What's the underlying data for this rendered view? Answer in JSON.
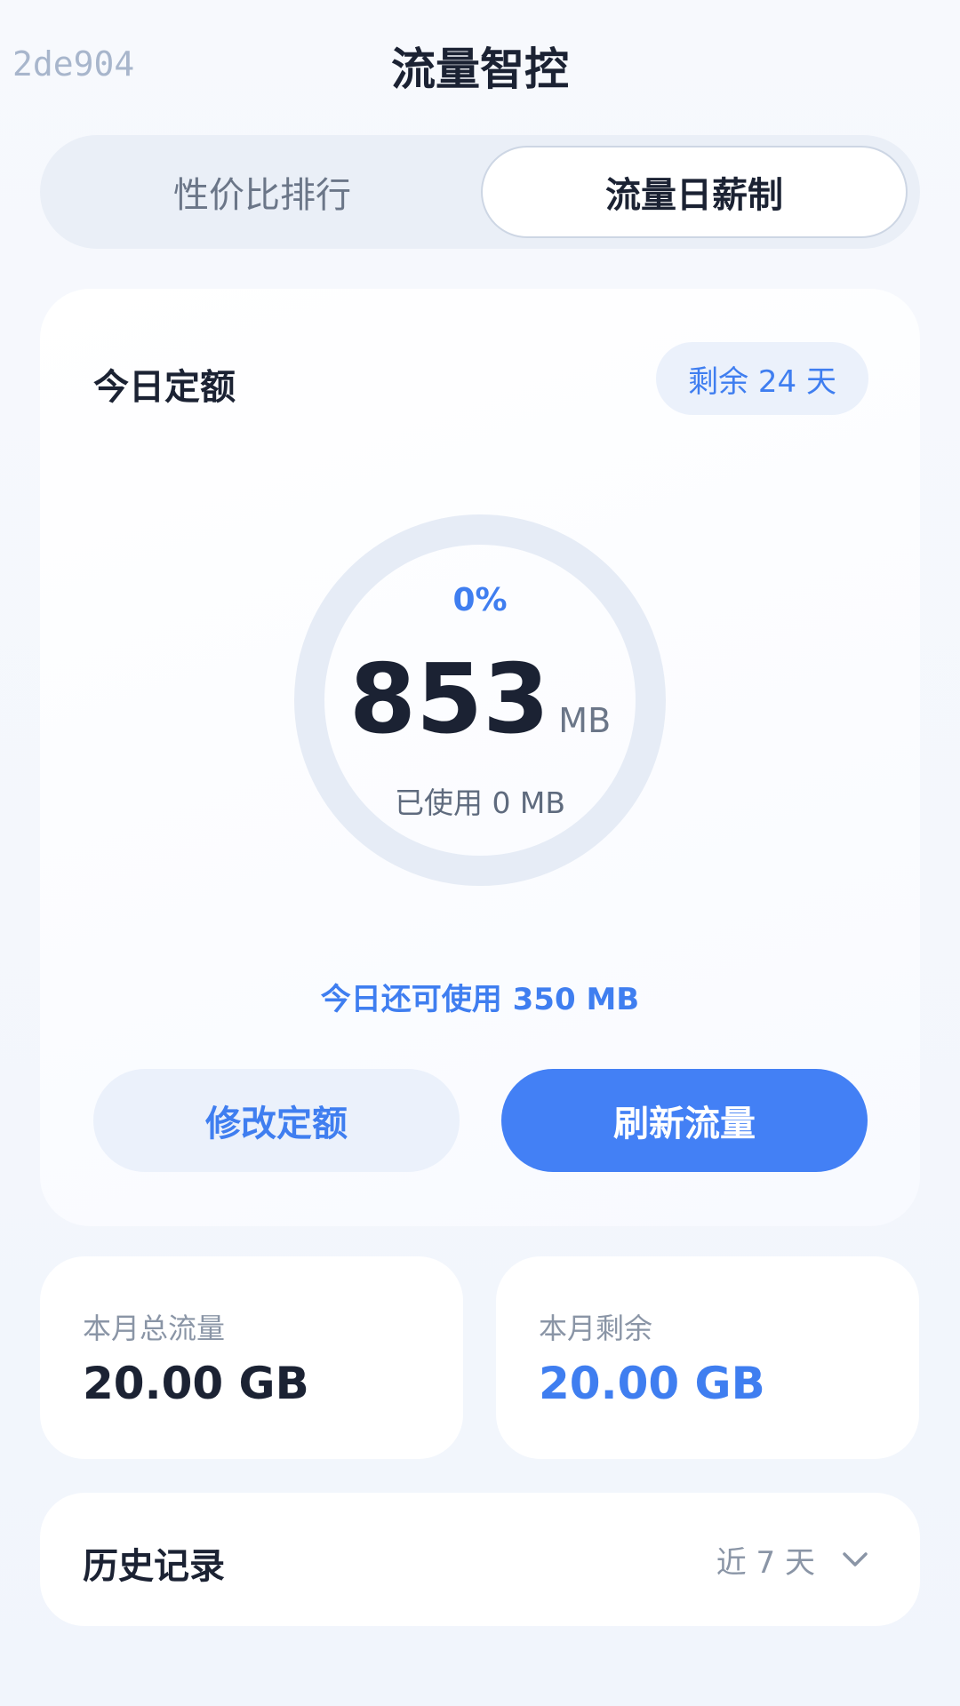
{
  "header": {
    "hash": "2de904",
    "title": "流量智控"
  },
  "tabs": [
    {
      "label": "性价比排行",
      "active": false
    },
    {
      "label": "流量日薪制",
      "active": true
    }
  ],
  "quota": {
    "title": "今日定额",
    "days_left": "剩余 24 天",
    "percent": "0%",
    "percent_value": 0,
    "value": "853",
    "unit": "MB",
    "used": "已使用 0 MB",
    "remaining_today": "今日还可使用 350 MB",
    "edit_label": "修改定额",
    "refresh_label": "刷新流量"
  },
  "stats": {
    "total_label": "本月总流量",
    "total_value": "20.00 GB",
    "left_label": "本月剩余",
    "left_value": "20.00 GB"
  },
  "history": {
    "title": "历史记录",
    "range": "近 7 天"
  },
  "colors": {
    "accent": "#3f7ef0",
    "primary_button": "#4380f5",
    "ring_track": "#e6ecf6"
  }
}
